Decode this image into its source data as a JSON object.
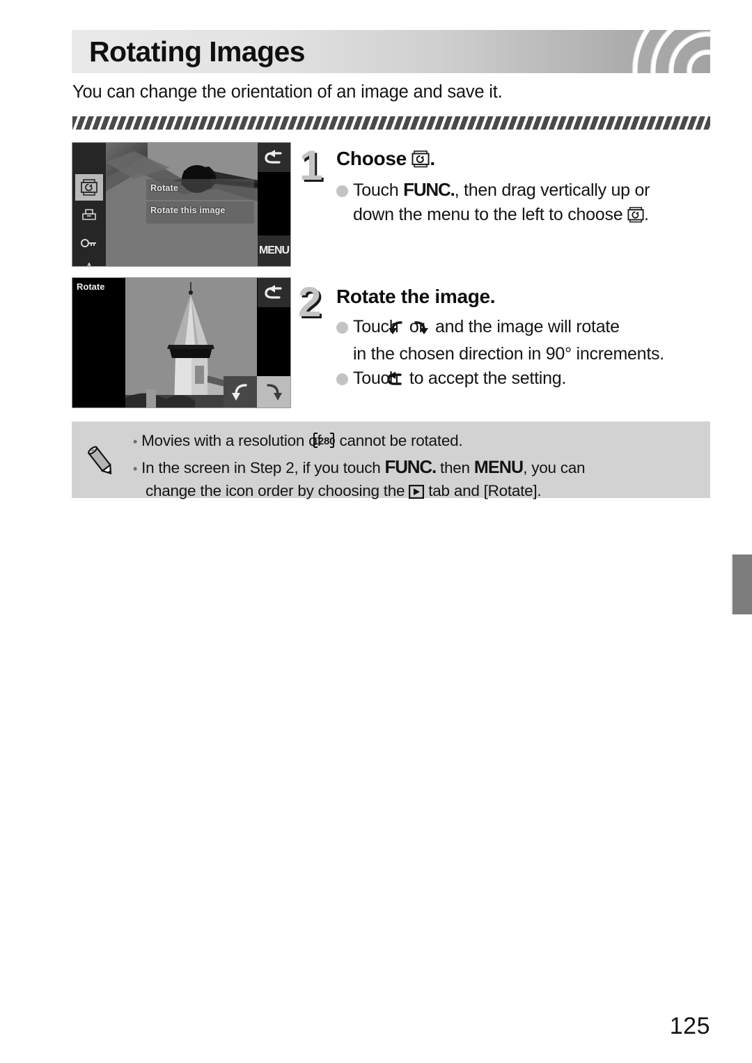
{
  "header": {
    "title": "Rotating Images",
    "intro": "You can change the orientation of an image and save it."
  },
  "steps": [
    {
      "number": "1",
      "title_prefix": "Choose",
      "title_icon": "rotate-icon",
      "title_suffix": ".",
      "lines": [
        "Touch",
        "FUNC.",
        ", then drag vertically up or",
        "down the menu to the left to choose",
        "."
      ]
    },
    {
      "number": "2",
      "title_prefix": "Rotate the image.",
      "title_icon": "",
      "title_suffix": "",
      "lines": [
        "Touch",
        "or",
        "and the image will rotate",
        "in the chosen direction in 90° increments.",
        "Touch",
        "to accept the setting."
      ]
    }
  ],
  "screenshot1": {
    "menu_items": [
      "rotate-icon",
      "print-icon",
      "protect-key-icon",
      "favorite-icon"
    ],
    "label_rotate": "Rotate",
    "label_rotate_this": "Rotate this image",
    "back_icon": "back-arrow-icon",
    "menu_button_label": "MENU"
  },
  "screenshot2": {
    "title": "Rotate",
    "back_icon": "back-arrow-icon",
    "rotate_ccw_icon": "rotate-counterclockwise-icon",
    "rotate_cw_icon": "rotate-clockwise-icon"
  },
  "note": {
    "icon": "pencil-icon",
    "items": [
      {
        "pre": "Movies with a resolution of",
        "icon": "1280",
        "post": "cannot be rotated."
      },
      {
        "pre": "In the screen in Step 2, if you touch",
        "func": "FUNC.",
        "mid": "then",
        "menu": "MENU",
        "post": ", you can",
        "line2_pre": "change the icon order by choosing the",
        "line2_icon": "playback-tab-icon",
        "line2_post": "tab and [Rotate]."
      }
    ]
  },
  "footer": {
    "page_number": "125"
  },
  "colors": {
    "header_light": "#e9e9e9",
    "header_dark": "#a2a2a2",
    "note_bg": "#d2d2d2",
    "step_number": "#c4c4c4",
    "bullet": "#c3c3c3",
    "edge_tab": "#7d7d7d"
  }
}
